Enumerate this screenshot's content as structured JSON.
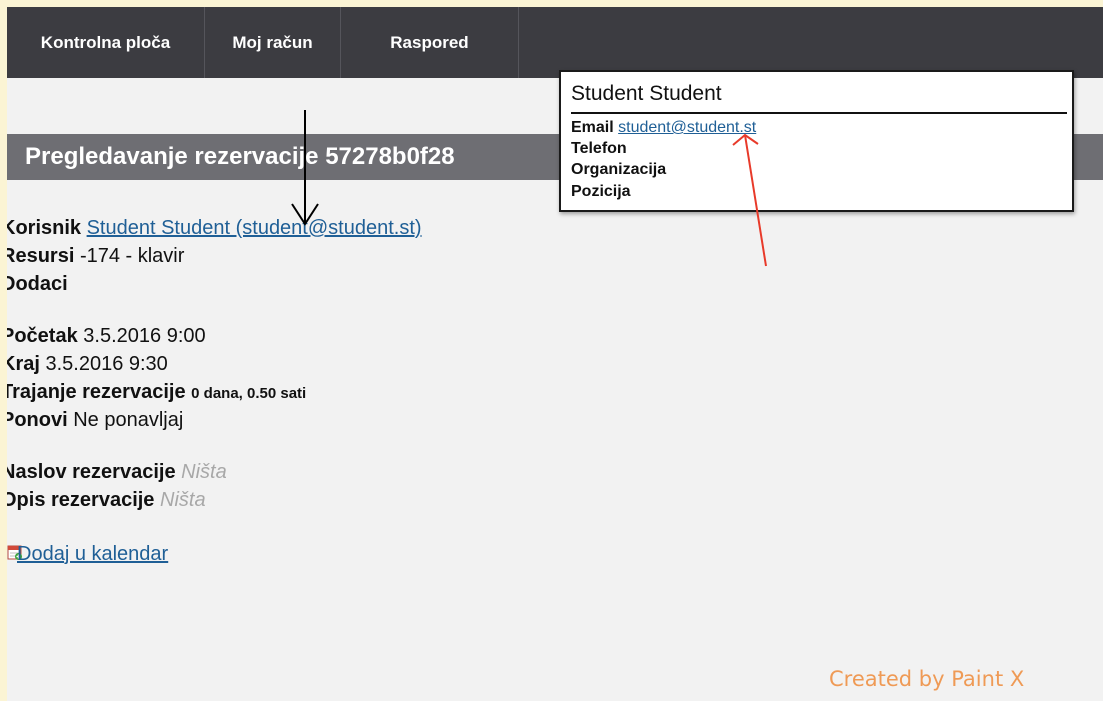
{
  "nav": {
    "items": [
      {
        "label": "Kontrolna ploča"
      },
      {
        "label": "Moj račun"
      },
      {
        "label": "Raspored"
      }
    ]
  },
  "title": "Pregledavanje rezervacije 57278b0f28",
  "details": {
    "user_label": "Korisnik",
    "user_value": "Student Student (student@student.st)",
    "resources_label": "Resursi",
    "resources_value": "-174 - klavir",
    "extras_label": "Dodaci",
    "start_label": "Početak",
    "start_value": "3.5.2016 9:00",
    "end_label": "Kraj",
    "end_value": "3.5.2016 9:30",
    "duration_label": "Trajanje rezervacije",
    "duration_value": "0 dana, 0.50 sati",
    "repeat_label": "Ponovi",
    "repeat_value": "Ne ponavljaj",
    "res_title_label": "Naslov rezervacije",
    "res_title_value": "Ništa",
    "res_desc_label": "Opis rezervacije",
    "res_desc_value": "Ništa",
    "calendar_link": " Dodaj u kalendar"
  },
  "popup": {
    "name": "Student Student",
    "email_label": "Email",
    "email_value": "student@student.st",
    "phone_label": "Telefon",
    "org_label": "Organizacija",
    "position_label": "Pozicija"
  },
  "watermark": "Created by Paint X",
  "colors": {
    "nav_bg": "#3c3c41",
    "title_bg": "#6e6e73",
    "link": "#1f5f96",
    "annotation_black": "#000000",
    "annotation_red": "#e83a2a",
    "watermark": "#ef9a55"
  }
}
